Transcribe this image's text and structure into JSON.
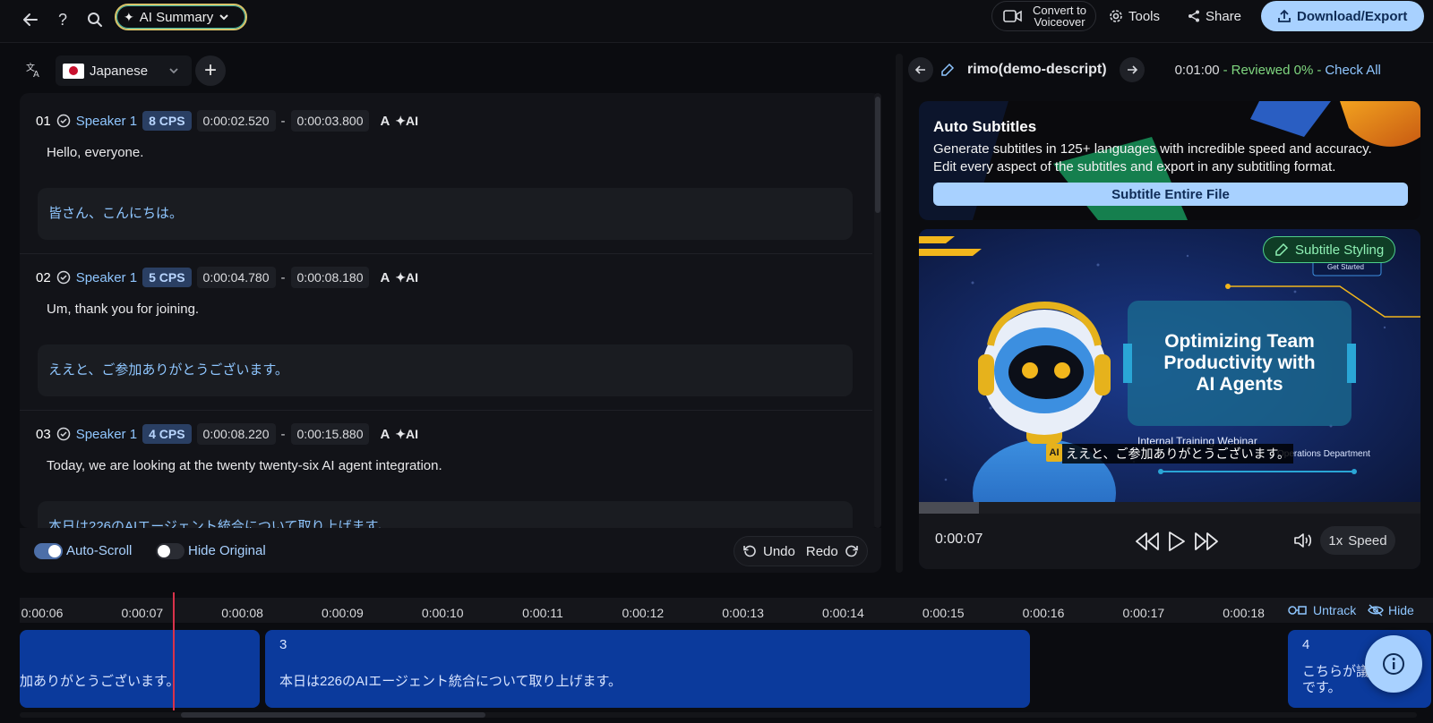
{
  "topbar": {
    "back_icon": "arrow-left-icon",
    "help_icon": "question-icon",
    "search_icon": "search-icon",
    "ai_summary_label": "AI Summary",
    "voiceover_line1": "Convert to",
    "voiceover_line2": "Voiceover",
    "tools_label": "Tools",
    "share_label": "Share",
    "download_label": "Download/Export"
  },
  "language": {
    "selected": "Japanese"
  },
  "segments": [
    {
      "num": "01",
      "speaker": "Speaker 1",
      "cps": "8 CPS",
      "start": "0:00:02.520",
      "end": "0:00:03.800",
      "original": "Hello, everyone.",
      "translation": "皆さん、こんにちは。"
    },
    {
      "num": "02",
      "speaker": "Speaker 1",
      "cps": "5 CPS",
      "start": "0:00:04.780",
      "end": "0:00:08.180",
      "original": "Um, thank you for joining.",
      "translation": "ええと、ご参加ありがとうございます。"
    },
    {
      "num": "03",
      "speaker": "Speaker 1",
      "cps": "4 CPS",
      "start": "0:00:08.220",
      "end": "0:00:15.880",
      "original": "Today, we are looking at the twenty twenty-six AI agent integration.",
      "translation": "本日は226のAIエージェント統合について取り上げます。"
    }
  ],
  "footer": {
    "auto_scroll": "Auto-Scroll",
    "hide_original": "Hide Original",
    "undo": "Undo",
    "redo": "Redo"
  },
  "project": {
    "name": "rimo(demo-descript)",
    "duration": "0:01:00",
    "reviewed": "Reviewed 0%",
    "check_all": "Check All"
  },
  "auto_subtitles": {
    "title": "Auto Subtitles",
    "desc1": "Generate subtitles in 125+ languages with incredible speed and accuracy.",
    "desc2": "Edit every aspect of the subtitles and export in any subtitling format.",
    "button": "Subtitle Entire File"
  },
  "video": {
    "styling_button": "Subtitle Styling",
    "get_started": "Get Started",
    "slide_title_1": "Optimizing Team",
    "slide_title_2": "Productivity with",
    "slide_title_3": "AI Agents",
    "webinar": "Internal Training Webinar",
    "department": "Operations Department",
    "robot_badge": "AI",
    "subtitle": "ええと、ご参加ありがとうございます。",
    "progress": 0.12,
    "current_time": "0:00:07",
    "speed": "1x",
    "speed_label": "Speed"
  },
  "timeline": {
    "ticks": [
      "0:00:06",
      "0:00:07",
      "0:00:08",
      "0:00:09",
      "0:00:10",
      "0:00:11",
      "0:00:12",
      "0:00:13",
      "0:00:14",
      "0:00:15",
      "0:00:16",
      "0:00:17",
      "0:00:18"
    ],
    "untrack": "Untrack",
    "hide": "Hide",
    "clips": [
      {
        "num": "",
        "text": "加ありがとうございます。"
      },
      {
        "num": "3",
        "text": "本日は226のAIエージェント統合について取り上げます。"
      },
      {
        "num": "4",
        "text_1": "こちらが議",
        "text_2": "です。"
      }
    ]
  },
  "colors": {
    "accent_blue": "#8fc6ff",
    "download_bg": "#a8d1ff",
    "reviewed_green": "#7fd67f",
    "clip_blue": "#0b3a9c",
    "playhead_red": "#d9334a"
  }
}
